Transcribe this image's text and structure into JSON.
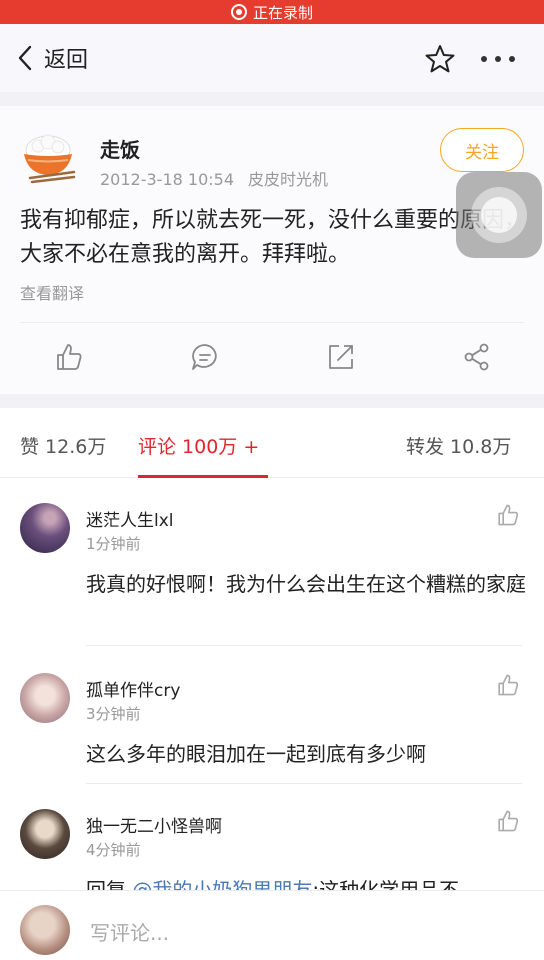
{
  "recording": {
    "label": "正在录制"
  },
  "nav": {
    "back_label": "返回"
  },
  "post": {
    "author": "走饭",
    "date": "2012-3-18 10:54",
    "source": "皮皮时光机",
    "follow_label": "关注",
    "text": "我有抑郁症，所以就去死一死，没什么重要的原因，大家不必在意我的离开。拜拜啦。",
    "translate_label": "查看翻译"
  },
  "tabs": {
    "likes": "赞 12.6万",
    "comments": "评论 100万 +",
    "reposts": "转发 10.8万"
  },
  "comments": [
    {
      "name": "迷茫人生lxl",
      "time": "1分钟前",
      "text": "我真的好恨啊！我为什么会出生在这个糟糕的家庭"
    },
    {
      "name": "孤单作伴cry",
      "time": "3分钟前",
      "text": "这么多年的眼泪加在一起到底有多少啊"
    },
    {
      "name": "独一无二小怪兽啊",
      "time": "4分钟前",
      "reply_prefix": "回复",
      "reply_mention": "@我的小奶狗男朋友",
      "reply_text": ":这种化学用品不"
    }
  ],
  "compose": {
    "placeholder": "写评论..."
  },
  "colors": {
    "recording_bar": "#e63c30",
    "accent": "#e1252e",
    "follow": "#f5a623",
    "link": "#4a7ab8"
  }
}
